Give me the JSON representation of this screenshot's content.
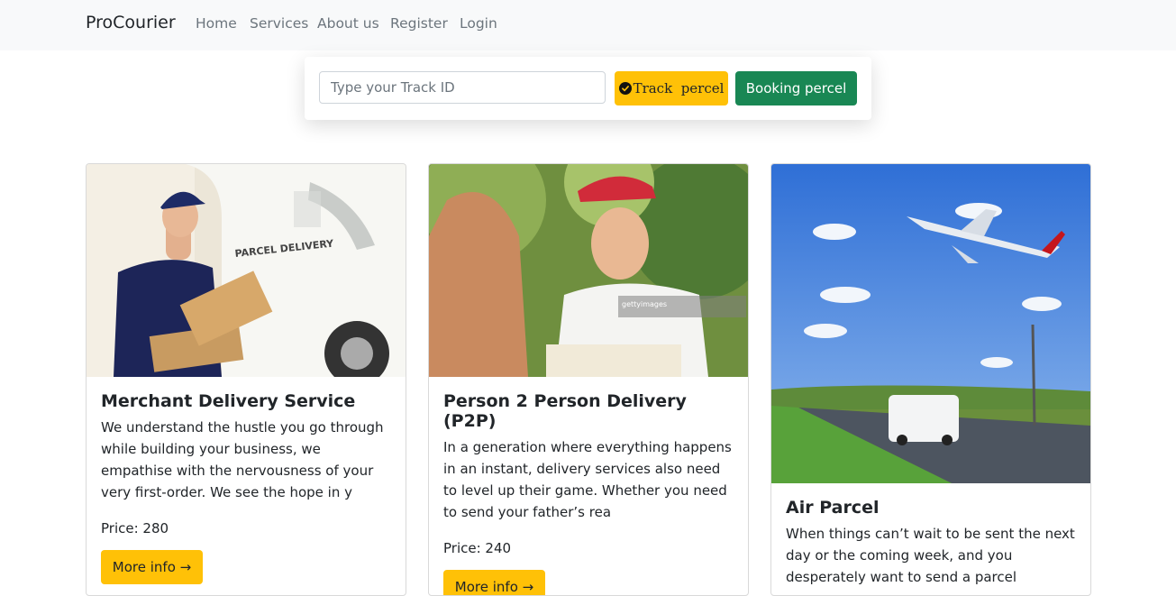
{
  "navbar": {
    "brand": "ProCourier",
    "links": [
      "Home",
      "Services",
      "About us",
      "Register",
      "Login"
    ]
  },
  "track": {
    "placeholder": "Type your Track ID",
    "track_button": "Track  percel",
    "booking_button": "Booking percel",
    "check_icon": "check-circle-icon"
  },
  "cards": [
    {
      "image_icon": "delivery-man-van-photo",
      "title": "Merchant Delivery Service",
      "text": "We understand the hustle you go through while building your business, we empathise with the nervousness of your very first-order. We see the hope in y",
      "price": "Price: 280",
      "button": "More info →",
      "photo_text": "PARCEL DELIVERY"
    },
    {
      "image_icon": "person-handing-parcel-photo",
      "title": "Person 2 Person Delivery (P2P)",
      "text": "In a generation where everything happens in an instant, delivery services also need to level up their game. Whether you need to send your father’s rea",
      "price": "Price: 240",
      "button": "More info →",
      "photo_text": "gettyimages"
    },
    {
      "image_icon": "airplane-van-road-photo",
      "title": "Air Parcel",
      "text": "When things can’t wait to be sent the next day or the coming week, and you desperately want to send a parcel",
      "price": "",
      "button": ""
    }
  ],
  "colors": {
    "warning": "#ffc107",
    "success": "#198754",
    "navbar_bg": "#f8f9fa",
    "muted": "#6c757d"
  }
}
